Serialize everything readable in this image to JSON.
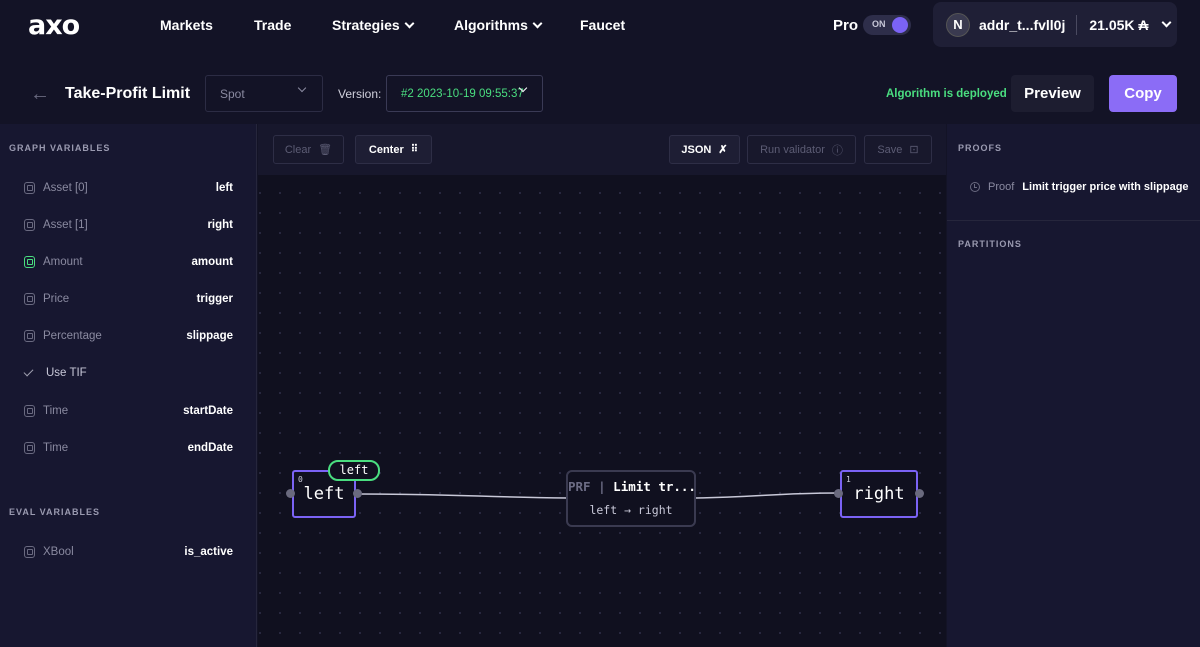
{
  "nav": {
    "logo": "axo",
    "items": [
      {
        "label": "Markets"
      },
      {
        "label": "Trade"
      },
      {
        "label": "Strategies"
      },
      {
        "label": "Algorithms"
      },
      {
        "label": "Faucet"
      }
    ],
    "pro_label": "Pro",
    "toggle_text": "ON",
    "wallet": {
      "avatar": "N",
      "address": "addr_t...fvll0j",
      "balance": "21.05K ₳"
    }
  },
  "header": {
    "title": "Take-Profit Limit",
    "market_type": "Spot",
    "version_label": "Version:",
    "version_value": "#2 2023-10-19 09:55:37",
    "status": "Algorithm is deployed",
    "preview_label": "Preview",
    "copy_label": "Copy"
  },
  "graph_variables": {
    "title": "GRAPH VARIABLES",
    "items": [
      {
        "type": "Asset [0]",
        "name": "left"
      },
      {
        "type": "Asset [1]",
        "name": "right"
      },
      {
        "type": "Amount",
        "name": "amount"
      },
      {
        "type": "Price",
        "name": "trigger"
      },
      {
        "type": "Percentage",
        "name": "slippage"
      },
      {
        "type": "Use TIF",
        "name": ""
      },
      {
        "type": "Time",
        "name": "startDate"
      },
      {
        "type": "Time",
        "name": "endDate"
      }
    ]
  },
  "eval_variables": {
    "title": "EVAL VARIABLES",
    "items": [
      {
        "type": "XBool",
        "name": "is_active"
      }
    ]
  },
  "toolbar": {
    "clear_label": "Clear",
    "center_label": "Center",
    "json_label": "JSON",
    "run_validator_label": "Run validator",
    "save_label": "Save"
  },
  "canvas": {
    "node_left": {
      "index": "0",
      "label": "left",
      "tag": "left"
    },
    "node_proof": {
      "kind": "PRF",
      "separator": "|",
      "name": "Limit tr...",
      "args": "left → right"
    },
    "node_right": {
      "index": "1",
      "label": "right"
    }
  },
  "right_panel": {
    "proofs_title": "PROOFS",
    "proof": {
      "kind": "Proof",
      "name": "Limit trigger price with slippage"
    },
    "partitions_title": "PARTITIONS"
  },
  "colors": {
    "accent": "#8b6cf6",
    "success": "#4ade80",
    "background": "#131326"
  }
}
